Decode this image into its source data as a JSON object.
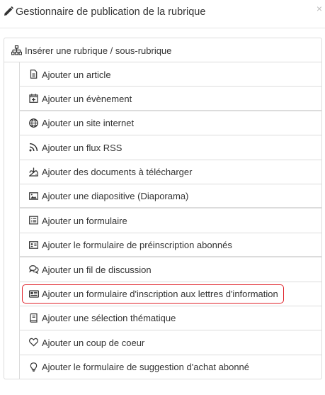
{
  "dialog": {
    "title": "Gestionnaire de publication de la rubrique",
    "title_icon": "pencil-icon",
    "close_glyph": "×"
  },
  "root_item": {
    "label": "Insérer une rubrique / sous-rubrique",
    "icon": "sitemap-icon"
  },
  "items": [
    {
      "label": "Ajouter un article",
      "icon": "file-text-icon"
    },
    {
      "label": "Ajouter un évènement",
      "icon": "calendar-plus-icon"
    },
    {
      "label": "Ajouter un site internet",
      "icon": "globe-icon"
    },
    {
      "label": "Ajouter un flux RSS",
      "icon": "rss-icon"
    },
    {
      "label": "Ajouter des documents à télécharger",
      "icon": "download-tray-icon"
    },
    {
      "label": "Ajouter une diapositive (Diaporama)",
      "icon": "image-icon"
    },
    {
      "label": "Ajouter un formulaire",
      "icon": "list-alt-icon"
    },
    {
      "label": "Ajouter le formulaire de préinscription abonnés",
      "icon": "id-card-icon"
    },
    {
      "label": "Ajouter un fil de discussion",
      "icon": "comments-icon"
    },
    {
      "label": "Ajouter un formulaire d'inscription aux lettres d'information",
      "icon": "newspaper-icon"
    },
    {
      "label": "Ajouter une sélection thématique",
      "icon": "book-icon"
    },
    {
      "label": "Ajouter un coup de coeur",
      "icon": "heart-icon"
    },
    {
      "label": "Ajouter le formulaire de suggestion d'achat abonné",
      "icon": "lightbulb-icon"
    }
  ],
  "highlight_color": "#e0252d"
}
